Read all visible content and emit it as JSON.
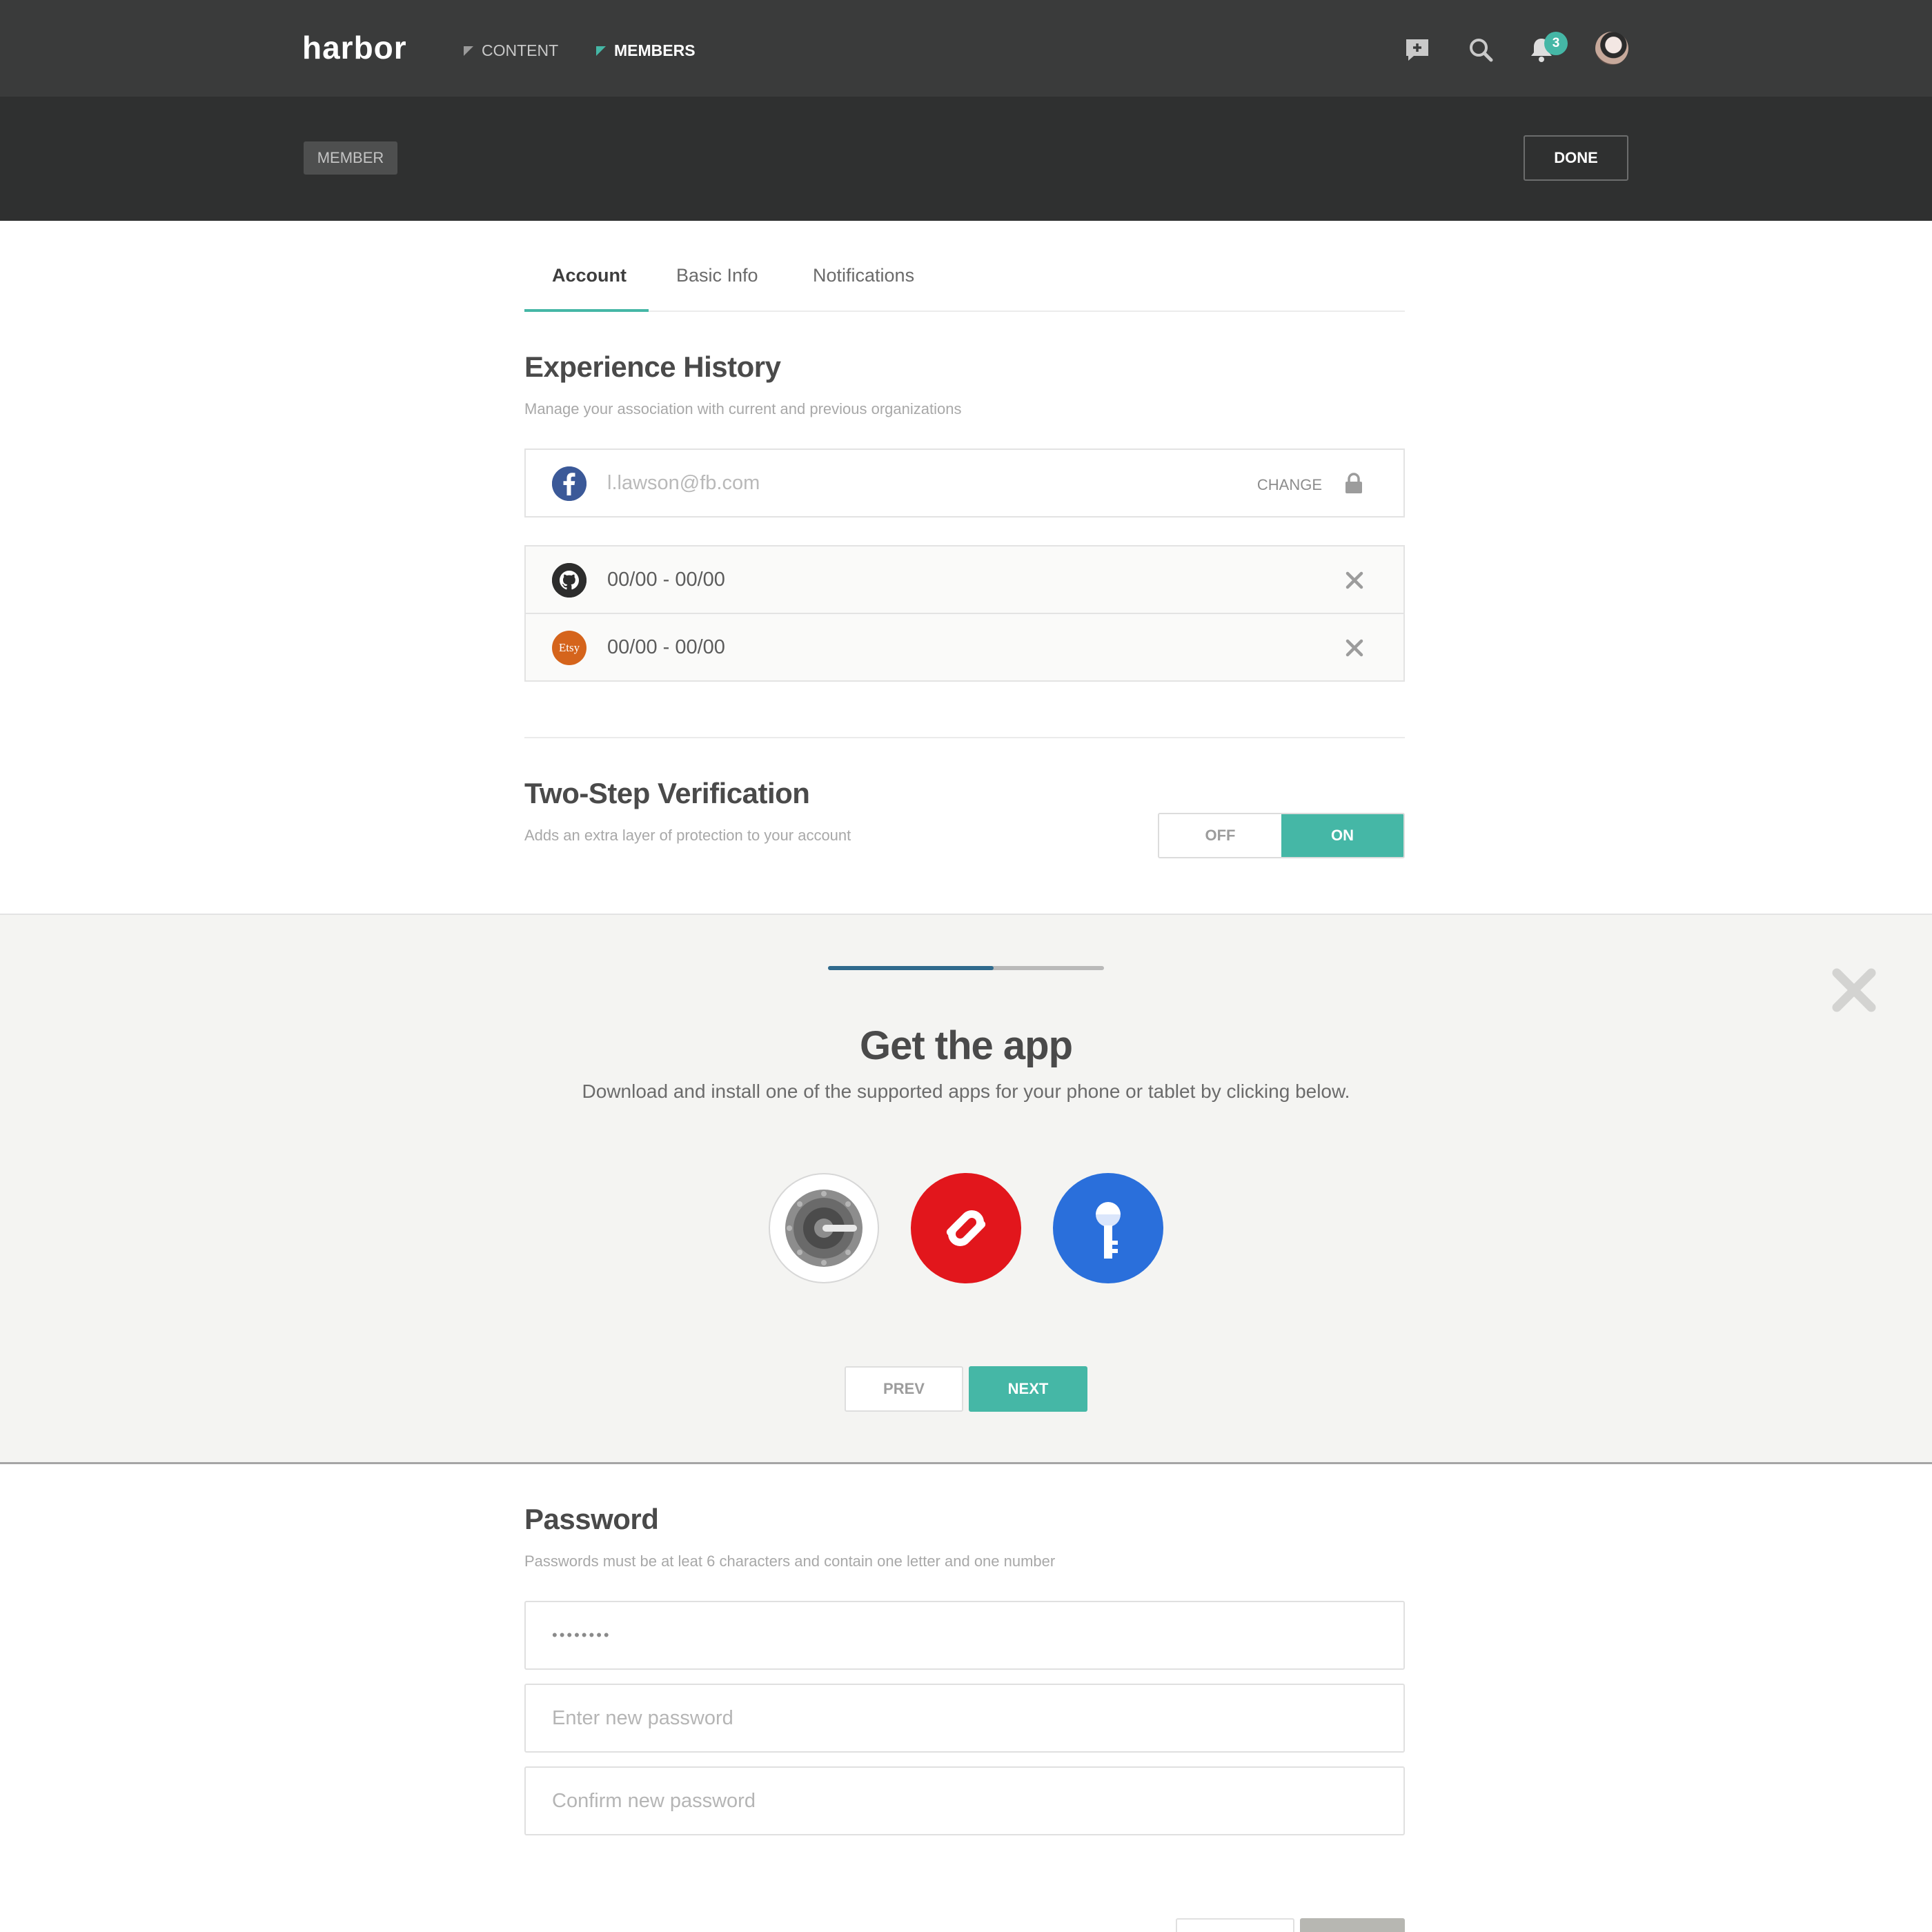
{
  "app": {
    "logo": "harbor"
  },
  "nav": {
    "items": [
      {
        "label": "CONTENT"
      },
      {
        "label": "MEMBERS"
      }
    ]
  },
  "header": {
    "notification_count": "3",
    "icons": [
      "new-post-icon",
      "search-icon",
      "bell-icon",
      "avatar"
    ]
  },
  "subheader": {
    "tag": "MEMBER",
    "done_label": "DONE"
  },
  "tabs": [
    {
      "label": "Account"
    },
    {
      "label": "Basic Info"
    },
    {
      "label": "Notifications"
    }
  ],
  "experience": {
    "title": "Experience History",
    "description": "Manage your association with current and previous organizations",
    "primary": {
      "icon": "facebook-icon",
      "email": "l.lawson@fb.com",
      "change_label": "CHANGE"
    },
    "entries": [
      {
        "icon": "github-icon",
        "dates": "00/00 - 00/00"
      },
      {
        "icon": "etsy-icon",
        "icon_text": "Etsy",
        "dates": "00/00 - 00/00"
      }
    ]
  },
  "two_step": {
    "title": "Two-Step Verification",
    "description": "Adds an extra layer of protection to your account",
    "off_label": "OFF",
    "on_label": "ON",
    "selected": "ON"
  },
  "get_app": {
    "progress": 0.6,
    "title": "Get the app",
    "description": "Download and install one of the supported apps for your phone or tablet by clicking below.",
    "apps": [
      "google-authenticator-icon",
      "authy-icon",
      "key-app-icon"
    ],
    "prev_label": "PREV",
    "next_label": "NEXT"
  },
  "password": {
    "title": "Password",
    "description": "Passwords must be at leat 6 characters and contain one letter and one number",
    "current_value": "••••••••",
    "new_placeholder": "Enter new password",
    "confirm_placeholder": "Confirm new password"
  },
  "colors": {
    "accent": "#45b7a6",
    "topbar": "#3a3b3b",
    "subbar": "#2f3030",
    "progress": "#2f6a8d"
  }
}
